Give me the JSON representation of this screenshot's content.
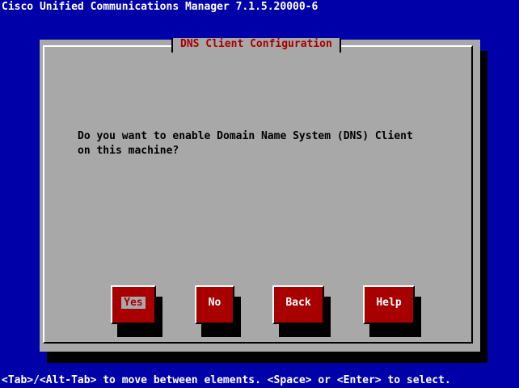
{
  "app": {
    "title": "Cisco Unified Communications Manager 7.1.5.20000-6"
  },
  "dialog": {
    "title": "DNS Client Configuration",
    "message": "Do you want to enable Domain Name System (DNS) Client\non this machine?"
  },
  "buttons": {
    "yes": "Yes",
    "no": "No",
    "back": "Back",
    "help": "Help"
  },
  "status_bar": {
    "text": "<Tab>/<Alt-Tab> to move between elements. <Space> or <Enter> to select."
  },
  "colors": {
    "background": "#0000a8",
    "dialog": "#a8a8a8",
    "button": "#a80000",
    "title_text": "#a80000"
  }
}
